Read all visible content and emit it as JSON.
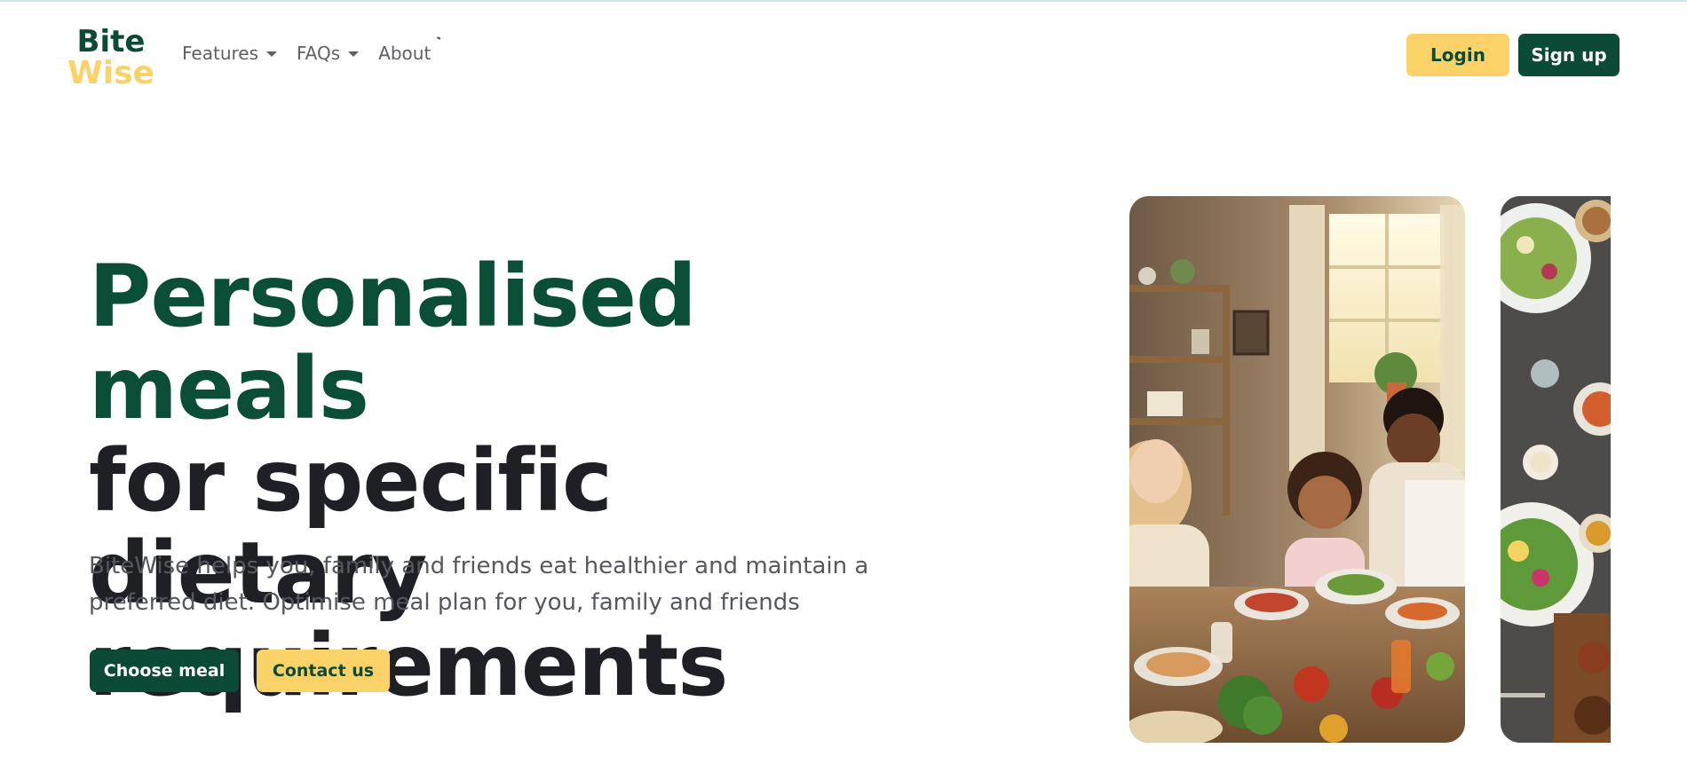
{
  "brand": {
    "name": "BiteWise",
    "logo_line1": "Bite",
    "logo_line2": "Wise",
    "colors": {
      "primary": "#0b4a37",
      "accent": "#fbd268",
      "text": "#1f2026",
      "muted": "#55585d"
    }
  },
  "nav": {
    "items": [
      {
        "label": "Features",
        "has_dropdown": true
      },
      {
        "label": "FAQs",
        "has_dropdown": true
      },
      {
        "label": "About",
        "has_dropdown": false
      }
    ],
    "login_label": "Login",
    "signup_label": "Sign up"
  },
  "hero": {
    "title_accent": "Personalised meals",
    "title_rest_line1": "for specific dietary",
    "title_rest_line2": "requirements",
    "subtitle": "BiteWise helps you, family and friends eat healthier and maintain a preferred diet. Optimise meal plan for you, family and friends",
    "primary_cta": "Choose meal",
    "secondary_cta": "Contact us"
  },
  "images": [
    {
      "icon": "family-dining-photo"
    },
    {
      "icon": "food-spread-photo"
    }
  ]
}
